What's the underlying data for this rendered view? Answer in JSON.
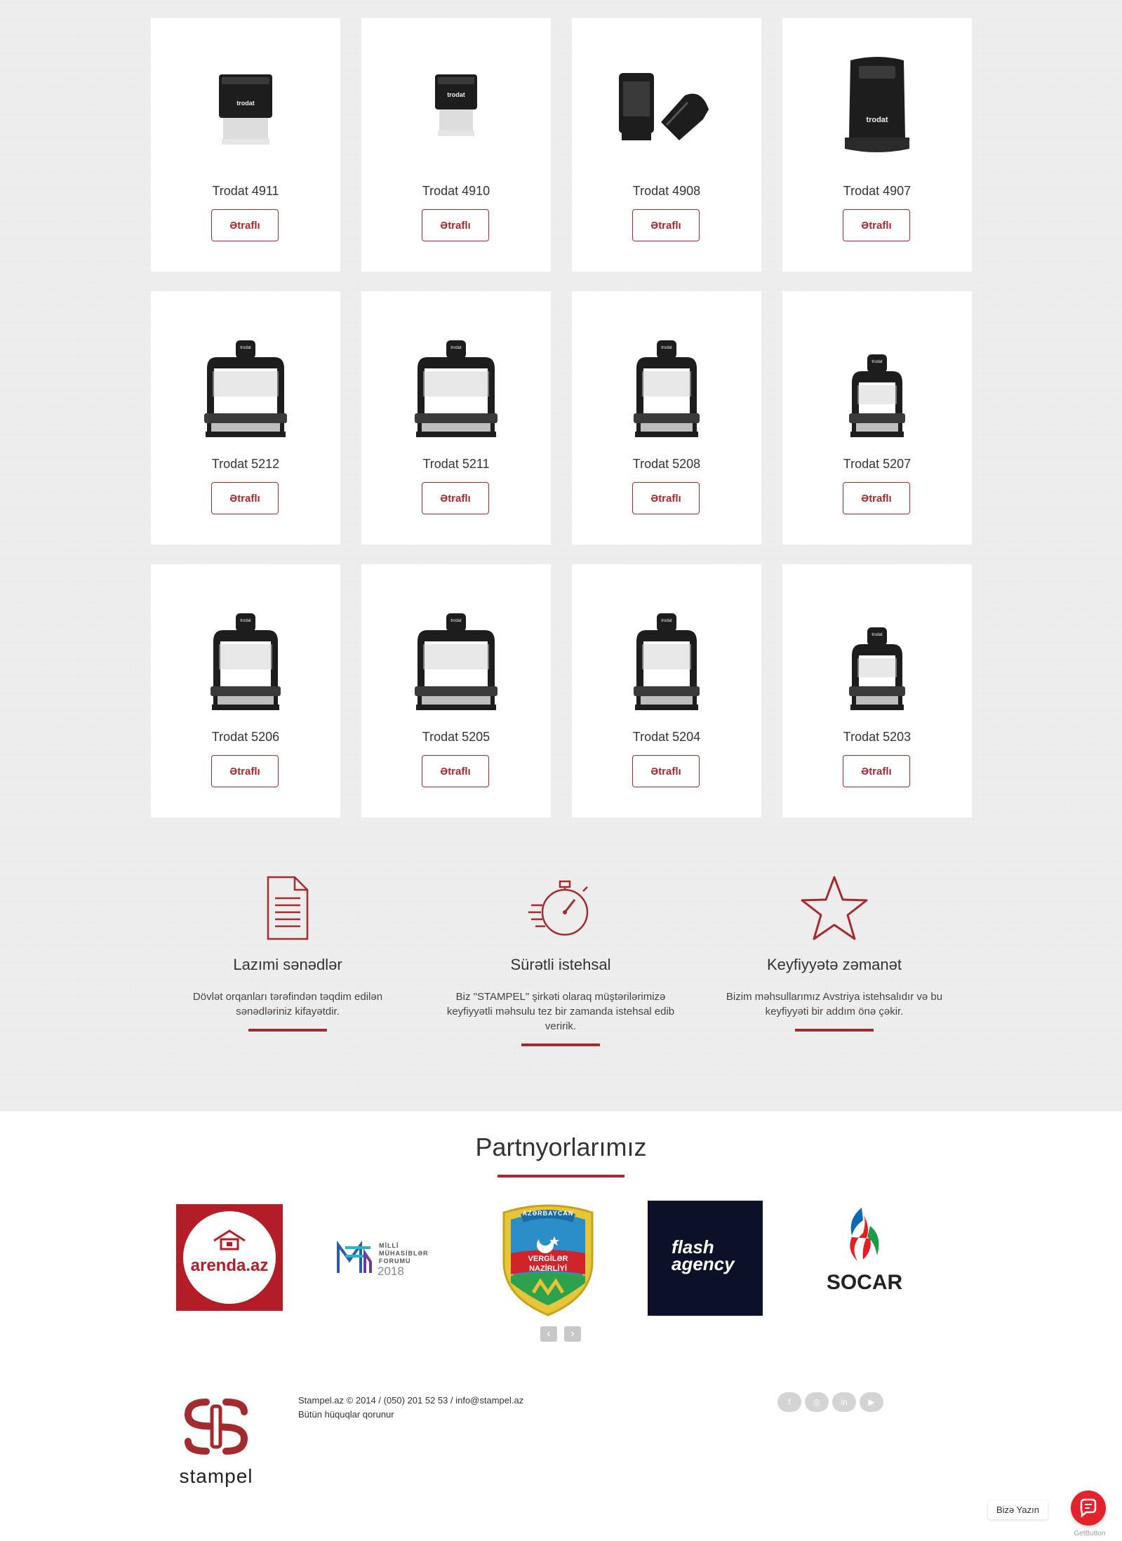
{
  "products": [
    {
      "name": "Trodat 4911",
      "button": "Ətraflı",
      "shape": "box-small"
    },
    {
      "name": "Trodat 4910",
      "button": "Ətraflı",
      "shape": "box-tiny"
    },
    {
      "name": "Trodat 4908",
      "button": "Ətraflı",
      "shape": "box-pair"
    },
    {
      "name": "Trodat 4907",
      "button": "Ətraflı",
      "shape": "box-tall"
    },
    {
      "name": "Trodat 5212",
      "button": "Ətraflı",
      "shape": "frame-wide"
    },
    {
      "name": "Trodat 5211",
      "button": "Ətraflı",
      "shape": "frame-wide"
    },
    {
      "name": "Trodat 5208",
      "button": "Ətraflı",
      "shape": "frame-mid"
    },
    {
      "name": "Trodat 5207",
      "button": "Ətraflı",
      "shape": "frame-small"
    },
    {
      "name": "Trodat 5206",
      "button": "Ətraflı",
      "shape": "frame-square"
    },
    {
      "name": "Trodat 5205",
      "button": "Ətraflı",
      "shape": "frame-wide"
    },
    {
      "name": "Trodat 5204",
      "button": "Ətraflı",
      "shape": "frame-mid"
    },
    {
      "name": "Trodat 5203",
      "button": "Ətraflı",
      "shape": "frame-small"
    }
  ],
  "stamp_brand_text": "trodat",
  "features": [
    {
      "icon": "document-icon",
      "title": "Lazımi sənədlər",
      "description": "Dövlət orqanları tərəfindən təqdim edilən sənədləriniz kifayətdir."
    },
    {
      "icon": "stopwatch-icon",
      "title": "Sürətli istehsal",
      "description": "Biz \"STAMPEL\" şirkəti olaraq müştərilərimizə keyfiyyətli məhsulu tez bir zamanda istehsal edib veririk."
    },
    {
      "icon": "star-icon",
      "title": "Keyfiyyətə zəmanət",
      "description": "Bizim məhsullarımız Avstriya istehsalıdır və bu keyfiyyəti bir addım önə çəkir."
    }
  ],
  "partners": {
    "title": "Partnyorlarımız",
    "logos": [
      {
        "name": "arenda.az"
      },
      {
        "name": "MİLLİ MÜHASİBLƏR FORUMU",
        "line1": "MİLLİ",
        "line2": "MÜHASİBLƏR",
        "line3": "FORUMU",
        "year": "2018"
      },
      {
        "name": "AZƏRBAYCAN VERGİLƏR NAZİRLİYİ",
        "top": "AZƏRBAYCAN",
        "line1": "VERGİLƏR",
        "line2": "NAZİRLİYİ"
      },
      {
        "name": "flash agency",
        "line1": "flash",
        "line2": "agency"
      },
      {
        "name": "SOCAR"
      }
    ],
    "prev": "‹",
    "next": "›"
  },
  "footer": {
    "copyright": "Stampel.az © 2014 / (050) 201 52 53 / info@stampel.az",
    "rights": "Bütün hüquqlar qorunur",
    "brand": "stampel",
    "social": [
      "f",
      "◎",
      "in",
      "▶"
    ]
  },
  "chat": {
    "label": "Bizə Yazın",
    "powered": "GetButton"
  },
  "colors": {
    "accent": "#a32a2f",
    "page_bg": "#efefef",
    "card_bg": "#ffffff",
    "socar_blue": "#0c6ab3",
    "socar_green": "#1c9a48",
    "socar_red": "#e31e25"
  }
}
